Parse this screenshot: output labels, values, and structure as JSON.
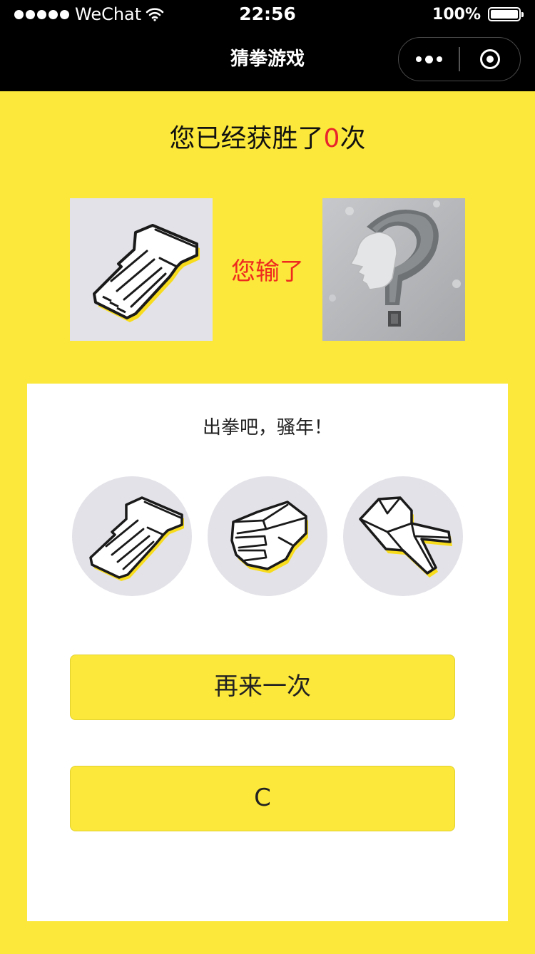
{
  "status_bar": {
    "carrier": "WeChat",
    "time": "22:56",
    "battery": "100%"
  },
  "nav": {
    "title": "猜拳游戏",
    "more_icon": "more-dots-icon",
    "close_icon": "target-close-icon"
  },
  "score": {
    "prefix": "您已经获胜了",
    "count": "0",
    "suffix": "次",
    "count_color": "#e8242c"
  },
  "result": {
    "player_choice_icon": "palm-hand-icon",
    "text": "您输了",
    "text_color": "#ee2a1f",
    "computer_choice_icon": "question-head-icon"
  },
  "panel": {
    "prompt": "出拳吧，骚年！",
    "choices": [
      {
        "icon": "palm-hand-icon"
      },
      {
        "icon": "fist-hand-icon"
      },
      {
        "icon": "scissors-hand-icon"
      }
    ],
    "again_button": "再来一次",
    "c_button": "C"
  },
  "colors": {
    "background": "#fbe83a",
    "button": "#fbe83a",
    "tile": "#e3e2e8",
    "topbar": "#000000"
  }
}
